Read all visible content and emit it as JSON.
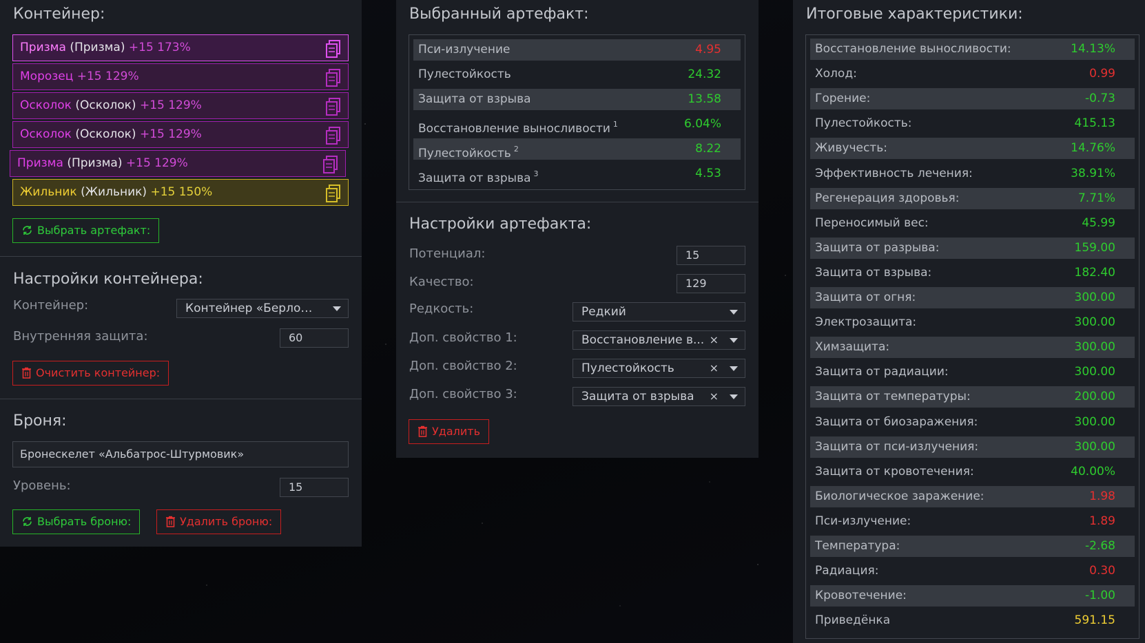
{
  "left": {
    "container_title": "Контейнер:",
    "slots": [
      {
        "name": "Призма",
        "sub": "(Призма)",
        "level": "+15 173%"
      },
      {
        "name": "Морозец",
        "sub": "",
        "level": "+15 129%"
      },
      {
        "name": "Осколок",
        "sub": "(Осколок)",
        "level": "+15 129%"
      },
      {
        "name": "Осколок",
        "sub": "(Осколок)",
        "level": "+15 129%"
      },
      {
        "name": "Призма",
        "sub": "(Призма)",
        "level": "+15 129%"
      },
      {
        "name": "Жильник",
        "sub": "(Жильник)",
        "level": "+15 150%"
      }
    ],
    "choose_artifact": "Выбрать артефакт:",
    "container_settings_title": "Настройки контейнера:",
    "container_label": "Контейнер:",
    "container_value": "Контейнер «Берлога...",
    "inner_protection_label": "Внутренняя защита:",
    "inner_protection_value": "60",
    "clear_container": "Очистить контейнер:",
    "armor_title": "Броня:",
    "armor_value": "Бронескелет «Альбатрос-Штурмовик»",
    "level_label": "Уровень:",
    "level_value": "15",
    "choose_armor": "Выбрать броню:",
    "delete_armor": "Удалить броню:"
  },
  "mid": {
    "selected_title": "Выбранный артефакт:",
    "stats": [
      {
        "label": "Пси-излучение",
        "sup": "",
        "value": "4.95",
        "tone": "neg"
      },
      {
        "label": "Пулестойкость",
        "sup": "",
        "value": "24.32",
        "tone": "pos"
      },
      {
        "label": "Защита от взрыва",
        "sup": "",
        "value": "13.58",
        "tone": "pos"
      },
      {
        "label": "Восстановление выносливости",
        "sup": "1",
        "value": "6.04%",
        "tone": "pos"
      },
      {
        "label": "Пулестойкость",
        "sup": "2",
        "value": "8.22",
        "tone": "pos"
      },
      {
        "label": "Защита от взрыва",
        "sup": "3",
        "value": "4.53",
        "tone": "pos"
      }
    ],
    "settings_title": "Настройки артефакта:",
    "potential_label": "Потенциал:",
    "potential_value": "15",
    "quality_label": "Качество:",
    "quality_value": "129",
    "rarity_label": "Редкость:",
    "rarity_value": "Редкий",
    "prop1_label": "Доп. свойство 1:",
    "prop1_value": "Восстановление в...",
    "prop2_label": "Доп. свойство 2:",
    "prop2_value": "Пулестойкость",
    "prop3_label": "Доп. свойство 3:",
    "prop3_value": "Защита от взрыва",
    "clear_mark": "×",
    "delete": "Удалить"
  },
  "right": {
    "title": "Итоговые характеристики:",
    "stats": [
      {
        "label": "Восстановление выносливости:",
        "value": "14.13%",
        "tone": "pos"
      },
      {
        "label": "Холод:",
        "value": "0.99",
        "tone": "neg"
      },
      {
        "label": "Горение:",
        "value": "-0.73",
        "tone": "pos"
      },
      {
        "label": "Пулестойкость:",
        "value": "415.13",
        "tone": "pos"
      },
      {
        "label": "Живучесть:",
        "value": "14.76%",
        "tone": "pos"
      },
      {
        "label": "Эффективность лечения:",
        "value": "38.91%",
        "tone": "pos"
      },
      {
        "label": "Регенерация здоровья:",
        "value": "7.71%",
        "tone": "pos"
      },
      {
        "label": "Переносимый вес:",
        "value": "45.99",
        "tone": "pos"
      },
      {
        "label": "Защита от разрыва:",
        "value": "159.00",
        "tone": "pos"
      },
      {
        "label": "Защита от взрыва:",
        "value": "182.40",
        "tone": "pos"
      },
      {
        "label": "Защита от огня:",
        "value": "300.00",
        "tone": "pos"
      },
      {
        "label": "Электрозащита:",
        "value": "300.00",
        "tone": "pos"
      },
      {
        "label": "Химзащита:",
        "value": "300.00",
        "tone": "pos"
      },
      {
        "label": "Защита от радиации:",
        "value": "300.00",
        "tone": "pos"
      },
      {
        "label": "Защита от температуры:",
        "value": "200.00",
        "tone": "pos"
      },
      {
        "label": "Защита от биозаражения:",
        "value": "300.00",
        "tone": "pos"
      },
      {
        "label": "Защита от пси-излучения:",
        "value": "300.00",
        "tone": "pos"
      },
      {
        "label": "Защита от кровотечения:",
        "value": "40.00%",
        "tone": "pos"
      },
      {
        "label": "Биологическое заражение:",
        "value": "1.98",
        "tone": "neg"
      },
      {
        "label": "Пси-излучение:",
        "value": "1.89",
        "tone": "neg"
      },
      {
        "label": "Температура:",
        "value": "-2.68",
        "tone": "pos"
      },
      {
        "label": "Радиация:",
        "value": "0.30",
        "tone": "neg"
      },
      {
        "label": "Кровотечение:",
        "value": "-1.00",
        "tone": "pos"
      },
      {
        "label": "Приведёнка",
        "value": "591.15",
        "tone": "yel"
      }
    ]
  }
}
